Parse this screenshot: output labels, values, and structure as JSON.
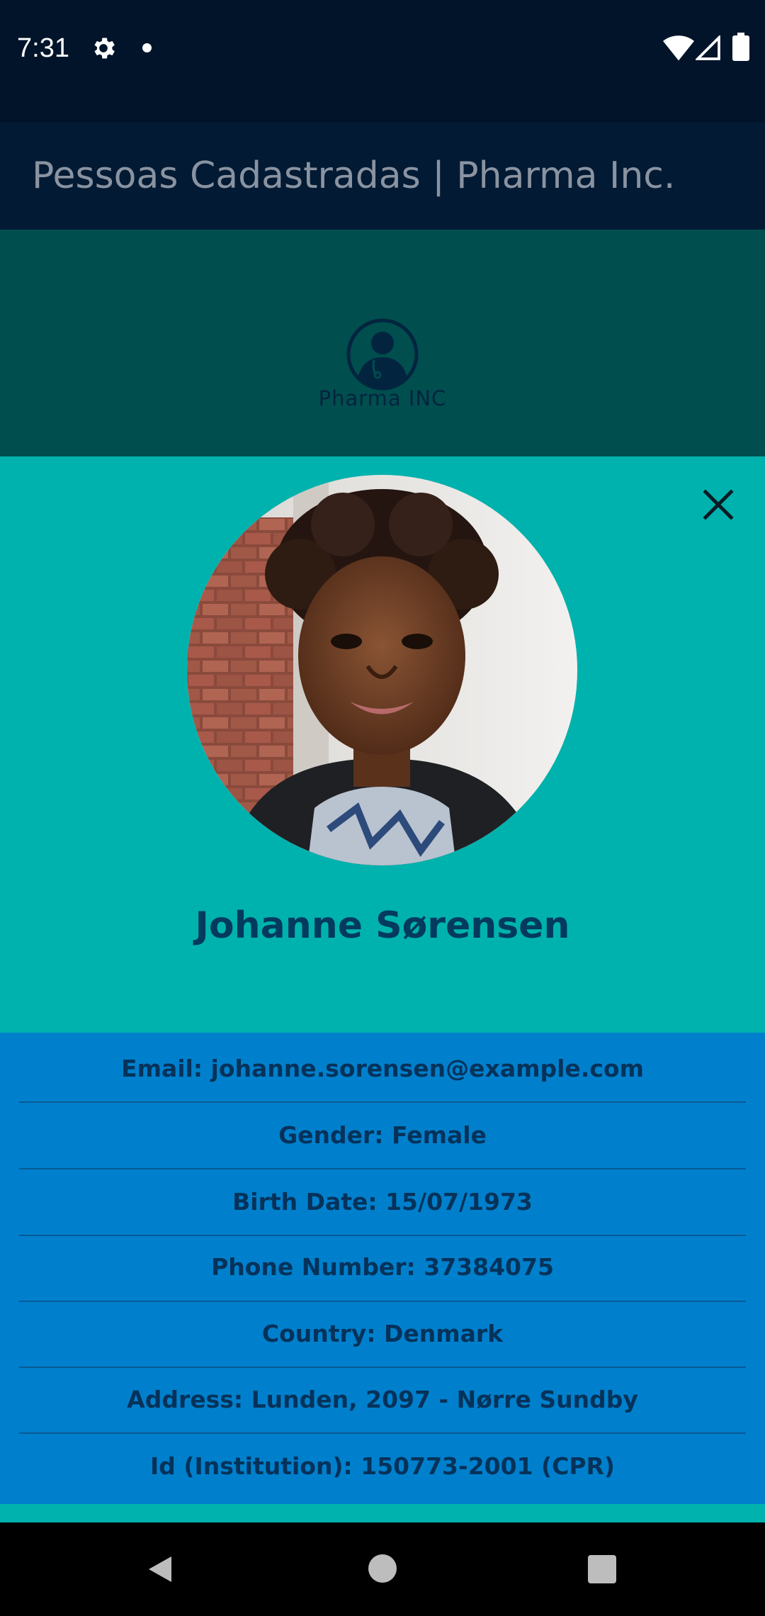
{
  "status_bar": {
    "time": "7:31",
    "icons": [
      "gear-icon",
      "notification-dot-icon",
      "wifi-icon",
      "cell-signal-icon",
      "battery-icon"
    ]
  },
  "app_bar": {
    "title": "Pessoas Cadastradas | Pharma Inc."
  },
  "logo": {
    "text": "Pharma INC",
    "icon": "doctor-avatar-icon"
  },
  "modal": {
    "close_icon": "close-icon",
    "photo": "person-photo",
    "name": "Johanne Sørensen",
    "details": [
      "Email: johanne.sorensen@example.com",
      "Gender: Female",
      "Birth Date: 15/07/1973",
      "Phone Number: 37384075",
      "Country: Denmark",
      "Address: Lunden, 2097 - Nørre Sundby",
      "Id (Institution): 150773-2001 (CPR)"
    ]
  },
  "navigation_bar": {
    "icons": [
      "back-icon",
      "home-icon",
      "recents-icon"
    ]
  },
  "colors": {
    "status_bar": "#01142a",
    "app_bar": "#021a33",
    "logo_band": "#004e4e",
    "modal_bg": "#00b2ad",
    "details_bg": "#0080cc",
    "name_text": "#033a5e",
    "detail_text": "#06325a"
  }
}
